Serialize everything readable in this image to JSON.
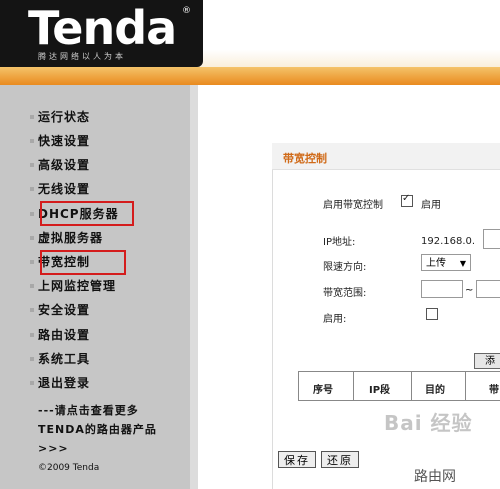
{
  "brand": {
    "logo": "Tenda",
    "registered": "®",
    "slogan": "腾达网络以人为本",
    "colors": {
      "header_dark": "#141414",
      "header_orange": "#e98a1f",
      "highlight": "#d41c1c"
    }
  },
  "sidebar": {
    "items": [
      {
        "label": "运行状态"
      },
      {
        "label": "快速设置"
      },
      {
        "label": "高级设置"
      },
      {
        "label": "无线设置"
      },
      {
        "label": "DHCP服务器"
      },
      {
        "label": "虚拟服务器"
      },
      {
        "label": "带宽控制"
      },
      {
        "label": "上网监控管理"
      },
      {
        "label": "安全设置"
      },
      {
        "label": "路由设置"
      },
      {
        "label": "系统工具"
      },
      {
        "label": "退出登录"
      }
    ],
    "more_line1": "---请点击查看更多",
    "more_line2": "TENDA的路由器产品",
    "more_line3": ">>>",
    "copyright": "©2009 Tenda"
  },
  "panel": {
    "title": "带宽控制",
    "enable_bandwidth_label": "启用带宽控制",
    "enable_bandwidth_checked": true,
    "enable_text": "启用",
    "ip_label": "IP地址:",
    "ip_prefix": "192.168.0.",
    "direction_label": "限速方向:",
    "direction_value": "上传",
    "range_label": "带宽范围:",
    "range_sep": "~",
    "enable_label": "启用:",
    "enable_checked": false,
    "add_button": "添",
    "table_headers": [
      "序号",
      "IP段",
      "目的",
      "带"
    ],
    "save_button": "保存",
    "restore_button": "还原"
  },
  "watermark": {
    "text": "Bai 经验",
    "site": "路由网"
  }
}
